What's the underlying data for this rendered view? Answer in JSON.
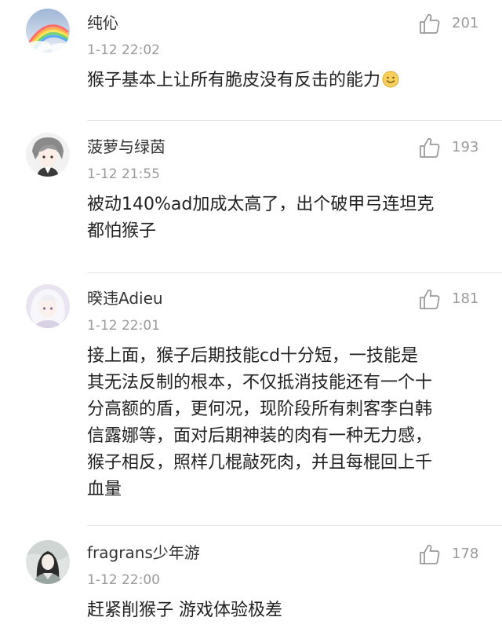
{
  "comments": [
    {
      "username": "纯伈",
      "time": "1-12 22:02",
      "likes": "201",
      "content": "猴子基本上让所有脆皮没有反击的能力",
      "emoji_icon": "smile-emoji-icon",
      "avatar_icon": "rainbow-sky-avatar-icon"
    },
    {
      "username": "菠萝与绿茵",
      "time": "1-12 21:55",
      "likes": "193",
      "content": "被动140%ad加成太高了，出个破甲弓连坦克\n都怕猴子",
      "avatar_icon": "anime-boy-avatar-icon"
    },
    {
      "username": "暌违Adieu",
      "time": "1-12 22:01",
      "likes": "181",
      "content": "接上面，猴子后期技能cd十分短，一技能是\n其无法反制的根本，不仅抵消技能还有一个十\n分高额的盾，更何况，现阶段所有刺客李白韩\n信露娜等，面对后期神装的肉有一种无力感，\n猴子相反，照样几棍敲死肉，并且每棍回上千\n血量",
      "avatar_icon": "white-hair-anime-avatar-icon"
    },
    {
      "username": "fragrans少年游",
      "time": "1-12 22:00",
      "likes": "178",
      "content": "赶紧削猴子 游戏体验极差",
      "avatar_icon": "ink-painting-avatar-icon"
    }
  ],
  "colors": {
    "text": "#222222",
    "username": "#333333",
    "meta": "#9a9a9a",
    "divider": "#e6e6e6"
  },
  "icons": {
    "like": "thumbs-up-icon"
  }
}
